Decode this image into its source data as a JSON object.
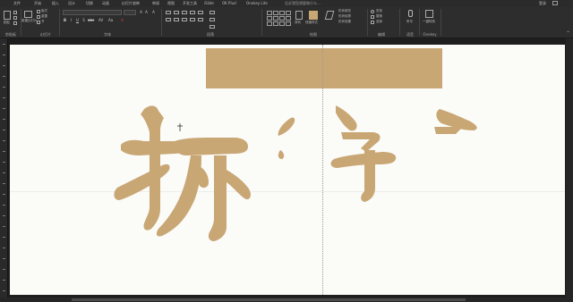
{
  "ribbon_tabs": [
    {
      "label": "文件"
    },
    {
      "label": "开始"
    },
    {
      "label": "插入"
    },
    {
      "label": "设计"
    },
    {
      "label": "切换"
    },
    {
      "label": "动画"
    },
    {
      "label": "幻灯片放映"
    },
    {
      "label": "审阅"
    },
    {
      "label": "视图"
    },
    {
      "label": "开发工具"
    },
    {
      "label": "iSlide"
    },
    {
      "label": "OK Plus!"
    },
    {
      "label": "Onekey Lite"
    }
  ],
  "tell_me": "告诉我您想要做什么...",
  "login": "登录",
  "groups": [
    {
      "label": "剪贴板"
    },
    {
      "label": "幻灯片"
    },
    {
      "label": "字体"
    },
    {
      "label": "段落"
    },
    {
      "label": "绘图"
    },
    {
      "label": "编辑"
    },
    {
      "label": "语音"
    },
    {
      "label": "Onekey"
    }
  ],
  "buttons": {
    "paste": "粘贴",
    "new_slide": "新建幻灯片",
    "layout": "版式",
    "reset": "重置",
    "section": "节",
    "font_size": "",
    "shape_fill": "形状填充",
    "shape_outline": "形状轮廓",
    "shape_effect": "形状效果",
    "arrange": "排列",
    "quick_styles": "快速样式",
    "find": "查找",
    "replace": "替换",
    "select": "选择",
    "dictate": "听写",
    "onekey": "一键特效"
  },
  "slide_glyphs": {
    "left_word": "拆",
    "right_word": "字"
  },
  "colors": {
    "accent_tan": "#c8a774",
    "ribbon_bg": "#2d2d2d",
    "canvas_bg": "#fbfbf8"
  }
}
